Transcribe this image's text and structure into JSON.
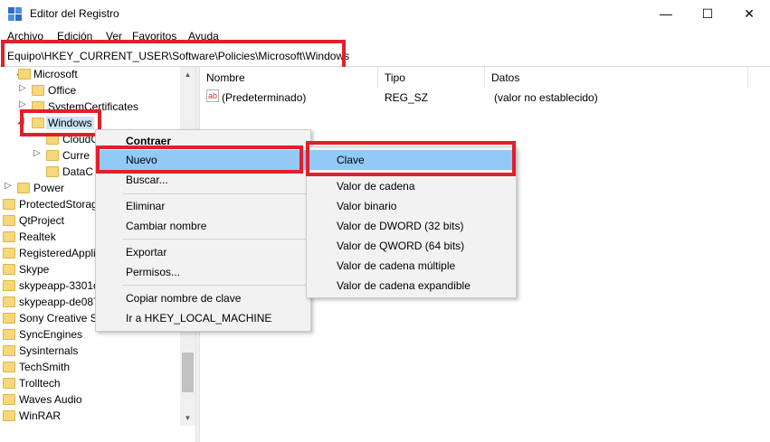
{
  "window": {
    "title": "Editor del Registro",
    "minimize": "—",
    "maximize": "☐",
    "close": "✕"
  },
  "menubar": {
    "items": [
      "Archivo",
      "Edición",
      "Ver",
      "Favoritos",
      "Ayuda"
    ]
  },
  "address": {
    "path": "Equipo\\HKEY_CURRENT_USER\\Software\\Policies\\Microsoft\\Windows"
  },
  "tree": {
    "items": [
      {
        "label": "Microsoft"
      },
      {
        "label": "Office"
      },
      {
        "label": "SystemCertificates"
      },
      {
        "label": "Windows"
      },
      {
        "label": "CloudC"
      },
      {
        "label": "Curre"
      },
      {
        "label": "DataC"
      },
      {
        "label": "Power"
      },
      {
        "label": "ProtectedStorag"
      },
      {
        "label": "QtProject"
      },
      {
        "label": "Realtek"
      },
      {
        "label": "RegisteredAppli"
      },
      {
        "label": "Skype"
      },
      {
        "label": "skypeapp-3301c"
      },
      {
        "label": "skypeapp-de087"
      },
      {
        "label": "Sony Creative So"
      },
      {
        "label": "SyncEngines"
      },
      {
        "label": "Sysinternals"
      },
      {
        "label": "TechSmith"
      },
      {
        "label": "Trolltech"
      },
      {
        "label": "Waves Audio"
      },
      {
        "label": "WinRAR"
      }
    ]
  },
  "list": {
    "columns": [
      "Nombre",
      "Tipo",
      "Datos"
    ],
    "rows": [
      {
        "name": "(Predeterminado)",
        "type": "REG_SZ",
        "data": "(valor no establecido)",
        "icon": "ab"
      }
    ]
  },
  "context_menu": {
    "items": [
      "Contraer",
      "Nuevo",
      "Buscar...",
      "Eliminar",
      "Cambiar nombre",
      "Exportar",
      "Permisos...",
      "Copiar nombre de clave",
      "Ir a HKEY_LOCAL_MACHINE"
    ],
    "submenu_arrow": "›"
  },
  "submenu": {
    "items": [
      "Clave",
      "Valor de cadena",
      "Valor binario",
      "Valor de DWORD (32 bits)",
      "Valor de QWORD (64 bits)",
      "Valor de cadena múltiple",
      "Valor de cadena expandible"
    ]
  },
  "icons": {
    "app": "registry-editor-icon",
    "folder": "folder-icon",
    "string_value": "string-value-icon",
    "expand": "▷",
    "collapse": "◢",
    "scroll_up": "▲",
    "scroll_down": "▼"
  },
  "colors": {
    "highlight": "#91c9f7",
    "annotation": "#e0202b",
    "folder": "#f6d77a",
    "menu_bg": "#f2f2f2"
  }
}
